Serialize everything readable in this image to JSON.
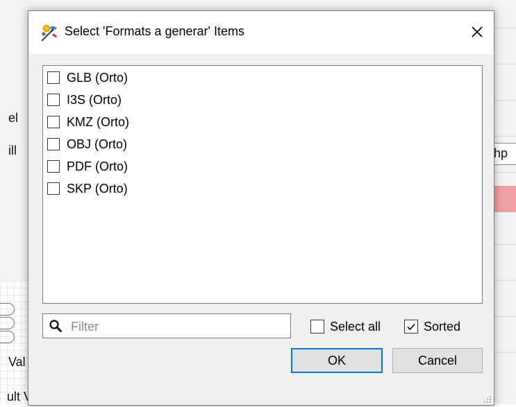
{
  "background": {
    "left_texts": [
      "el",
      "ill",
      "Val",
      "ult Values"
    ],
    "right_field_text": "hp"
  },
  "dialog": {
    "title": "Select 'Formats a generar' Items",
    "title_icon": "wizard-icon",
    "close_icon": "close-icon",
    "items": [
      {
        "label": "GLB (Orto)",
        "checked": false
      },
      {
        "label": "I3S (Orto)",
        "checked": false
      },
      {
        "label": "KMZ (Orto)",
        "checked": false
      },
      {
        "label": "OBJ (Orto)",
        "checked": false
      },
      {
        "label": "PDF (Orto)",
        "checked": false
      },
      {
        "label": "SKP (Orto)",
        "checked": false
      }
    ],
    "filter": {
      "placeholder": "Filter",
      "value": "",
      "icon": "search-icon"
    },
    "select_all": {
      "label": "Select all",
      "checked": false
    },
    "sorted": {
      "label": "Sorted",
      "checked": true
    },
    "ok_label": "OK",
    "cancel_label": "Cancel"
  },
  "colors": {
    "accent": "#0078d7",
    "dialog_bg": "#f0f0f0"
  }
}
